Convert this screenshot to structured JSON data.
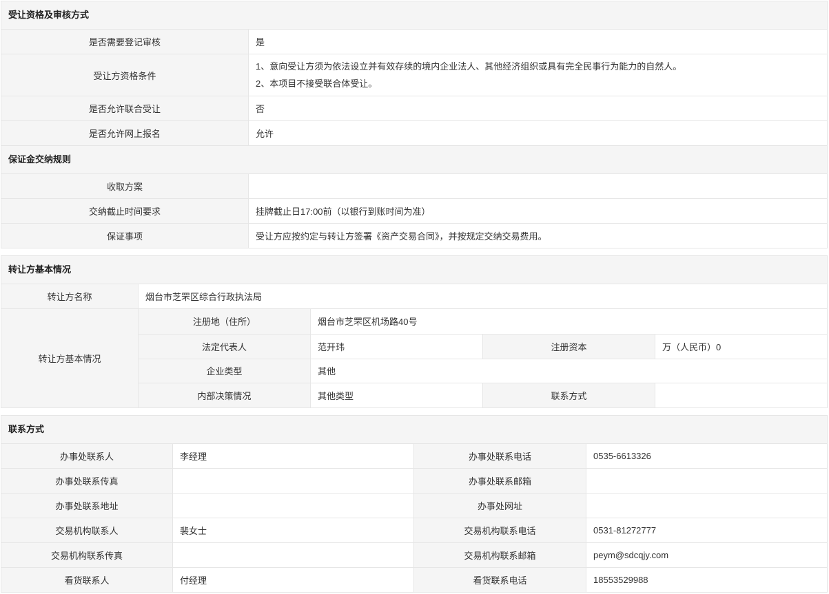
{
  "sec1": {
    "title": "受让资格及审核方式",
    "rows": [
      {
        "label": "是否需要登记审核",
        "value": "是"
      },
      {
        "label": "受让方资格条件",
        "lines": [
          "1、意向受让方须为依法设立并有效存续的境内企业法人、其他经济组织或具有完全民事行为能力的自然人。",
          "2、本项目不接受联合体受让。"
        ]
      },
      {
        "label": "是否允许联合受让",
        "value": "否"
      },
      {
        "label": "是否允许网上报名",
        "value": "允许"
      }
    ]
  },
  "sec2": {
    "title": "保证金交纳规则",
    "rows": [
      {
        "label": "收取方案",
        "value": ""
      },
      {
        "label": "交纳截止时间要求",
        "value": "挂牌截止日17:00前（以银行到账时间为准）"
      },
      {
        "label": "保证事项",
        "value": "受让方应按约定与转让方签署《资产交易合同》，并按规定交纳交易费用。"
      }
    ]
  },
  "sec3": {
    "title": "转让方基本情况",
    "name_label": "转让方名称",
    "name_value": "烟台市芝罘区综合行政执法局",
    "basic_label": "转让方基本情况",
    "address_label": "注册地（住所）",
    "address_value": "烟台市芝罘区机场路40号",
    "legal_label": "法定代表人",
    "legal_value": "范开玮",
    "capital_label": "注册资本",
    "capital_value": "万（人民币）0",
    "type_label": "企业类型",
    "type_value": "其他",
    "decision_label": "内部决策情况",
    "decision_value": "其他类型",
    "contact_label": "联系方式",
    "contact_value": ""
  },
  "sec4": {
    "title": "联系方式",
    "rows": [
      {
        "l1": "办事处联系人",
        "v1": "李经理",
        "l2": "办事处联系电话",
        "v2": "0535-6613326"
      },
      {
        "l1": "办事处联系传真",
        "v1": "",
        "l2": "办事处联系邮箱",
        "v2": ""
      },
      {
        "l1": "办事处联系地址",
        "v1": "",
        "l2": "办事处网址",
        "v2": ""
      },
      {
        "l1": "交易机构联系人",
        "v1": "裴女士",
        "l2": "交易机构联系电话",
        "v2": "0531-81272777"
      },
      {
        "l1": "交易机构联系传真",
        "v1": "",
        "l2": "交易机构联系邮箱",
        "v2": "peym@sdcqjy.com"
      },
      {
        "l1": "看货联系人",
        "v1": "付经理",
        "l2": "看货联系电话",
        "v2": "18553529988"
      }
    ]
  }
}
